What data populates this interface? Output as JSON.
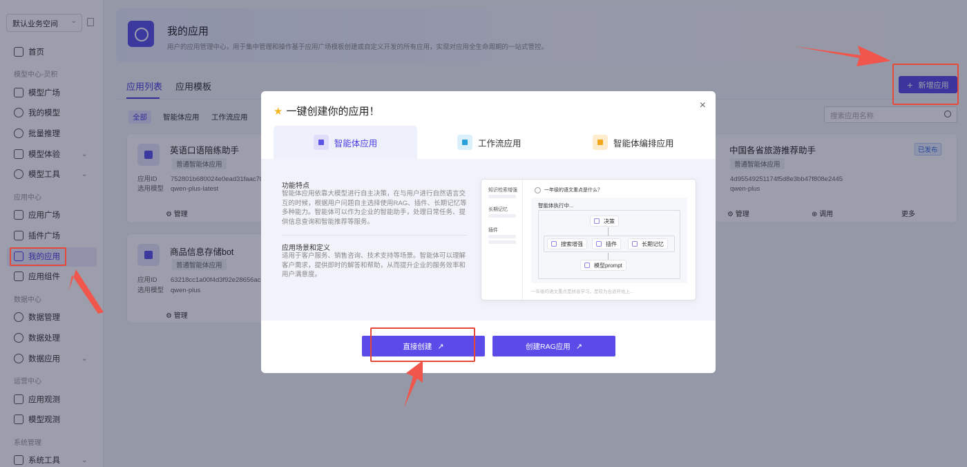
{
  "sidebar": {
    "workspace": "默认业务空间",
    "items": [
      {
        "label": "首页"
      },
      {
        "label": "模型广场"
      },
      {
        "label": "我的模型"
      },
      {
        "label": "批量推理"
      },
      {
        "label": "模型体验"
      },
      {
        "label": "模型工具"
      },
      {
        "label": "应用广场"
      },
      {
        "label": "插件广场"
      },
      {
        "label": "我的应用"
      },
      {
        "label": "应用组件"
      },
      {
        "label": "数据管理"
      },
      {
        "label": "数据处理"
      },
      {
        "label": "数据应用"
      },
      {
        "label": "应用观测"
      },
      {
        "label": "模型观测"
      },
      {
        "label": "系统工具"
      }
    ],
    "sections": [
      "模型中心-灵积",
      "应用中心",
      "数据中心",
      "运营中心",
      "系统管理"
    ]
  },
  "header": {
    "title": "我的应用",
    "subtitle": "用户的应用管理中心，用于集中管理和操作基于应用广场模板创建或自定义开发的所有应用，实现对应用全生命周期的一站式管控。"
  },
  "tabs": [
    "应用列表",
    "应用模板"
  ],
  "add_button": "新增应用",
  "filters": [
    "全部",
    "智能体应用",
    "工作流应用"
  ],
  "search_placeholder": "搜索应用名称",
  "cards": [
    {
      "title": "英语口语陪练助手",
      "tag": "普通智能体应用",
      "id_label": "应用ID",
      "id": "752801b680024e0ead31faac7092",
      "model_label": "选用模型",
      "model": "qwen-plus-latest",
      "action": "管理"
    },
    {
      "title": "商品信息存储bot",
      "tag": "普通智能体应用",
      "id_label": "应用ID",
      "id": "63218cc1a00f4d3f92e28656acc7c",
      "model_label": "选用模型",
      "model": "qwen-plus",
      "action": "管理"
    },
    {
      "title": "中国各省旅游推荐助手",
      "tag": "普通智能体应用",
      "badge": "已发布",
      "id": "4d95549251174f5d8e3bb47f808e2445",
      "model": "qwen-plus",
      "actions": [
        "管理",
        "调用",
        "更多"
      ]
    }
  ],
  "modal": {
    "title": "一键创建你的应用！",
    "tabs": [
      "智能体应用",
      "工作流应用",
      "智能体编排应用"
    ],
    "feature_title": "功能特点",
    "feature_text": "智能体应用依靠大模型进行自主决策，在与用户进行自然语言交互的时候，根据用户问题自主选择使用RAG、插件、长期记忆等多种能力。智能体可以作为企业的智能助手，处理日常任务、提供信息查询和智能推荐等服务。",
    "scene_title": "应用场景和定义",
    "scene_text": "适用于客户服务、销售咨询、技术支持等场景。智能体可以理解客户需求，提供即时的解答和帮助，从而提升企业的服务效率和用户满意度。",
    "preview": {
      "side_labels": [
        "知识检索增强",
        "长期记忆",
        "插件"
      ],
      "question": "一年级的语文重点是什么？",
      "running": "智能体执行中...",
      "node_decide": "决策",
      "node_search": "搜索增强",
      "node_plugin": "插件",
      "node_memory": "长期记忆",
      "node_prompt": "模型prompt",
      "input_hint": "一年级的语文重点是拼音学习，是较为合适开始上..."
    },
    "btn_direct": "直接创建",
    "btn_rag": "创建RAG应用",
    "close": "×"
  },
  "colors": {
    "accent": "#5b4be8",
    "annotation": "#e8483a"
  }
}
